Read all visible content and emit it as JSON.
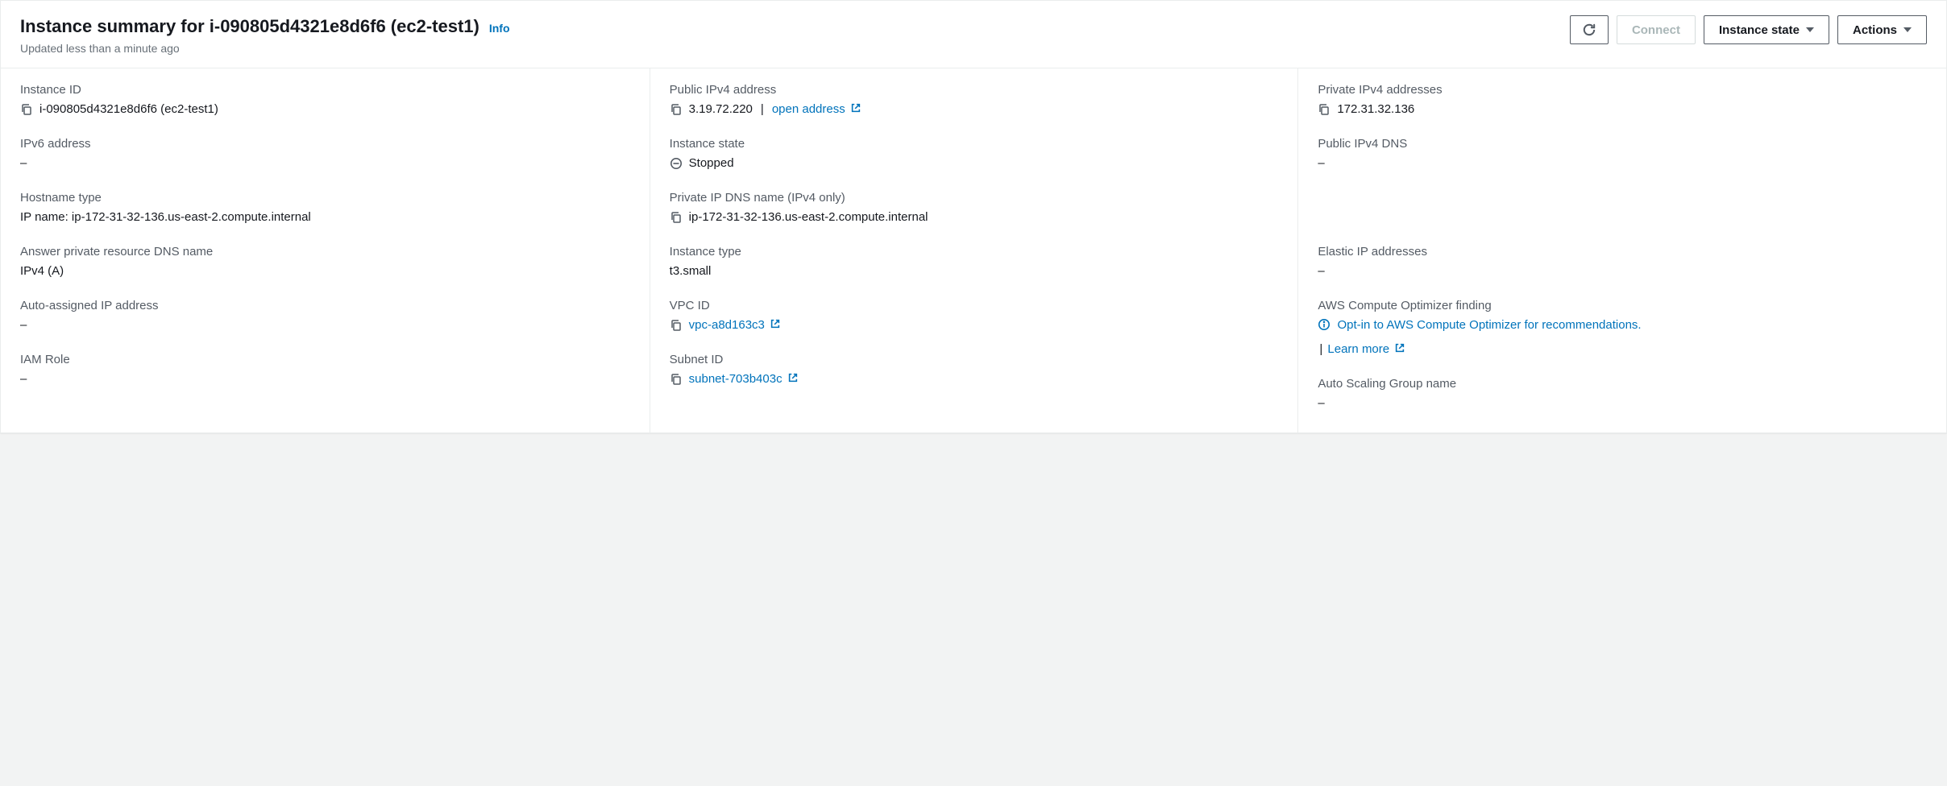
{
  "header": {
    "title_prefix": "Instance summary for ",
    "instance_id": "i-090805d4321e8d6f6",
    "instance_name": "ec2-test1",
    "info_label": "Info",
    "subtitle": "Updated less than a minute ago",
    "buttons": {
      "connect": "Connect",
      "instance_state": "Instance state",
      "actions": "Actions"
    }
  },
  "fields": {
    "instance_id": {
      "label": "Instance ID",
      "value": "i-090805d4321e8d6f6 (ec2-test1)"
    },
    "ipv6": {
      "label": "IPv6 address",
      "value": "–"
    },
    "hostname_type": {
      "label": "Hostname type",
      "value": "IP name: ip-172-31-32-136.us-east-2.compute.internal"
    },
    "answer_dns": {
      "label": "Answer private resource DNS name",
      "value": "IPv4 (A)"
    },
    "auto_ip": {
      "label": "Auto-assigned IP address",
      "value": "–"
    },
    "iam_role": {
      "label": "IAM Role",
      "value": "–"
    },
    "public_ipv4": {
      "label": "Public IPv4 address",
      "value": "3.19.72.220",
      "open": "open address"
    },
    "instance_state": {
      "label": "Instance state",
      "value": "Stopped"
    },
    "private_dns": {
      "label": "Private IP DNS name (IPv4 only)",
      "value": "ip-172-31-32-136.us-east-2.compute.internal"
    },
    "instance_type": {
      "label": "Instance type",
      "value": "t3.small"
    },
    "vpc_id": {
      "label": "VPC ID",
      "value": "vpc-a8d163c3"
    },
    "subnet_id": {
      "label": "Subnet ID",
      "value": "subnet-703b403c"
    },
    "private_ipv4": {
      "label": "Private IPv4 addresses",
      "value": "172.31.32.136"
    },
    "public_dns": {
      "label": "Public IPv4 DNS",
      "value": "–"
    },
    "elastic_ip": {
      "label": "Elastic IP addresses",
      "value": "–"
    },
    "optimizer": {
      "label": "AWS Compute Optimizer finding",
      "optin": "Opt-in to AWS Compute Optimizer for recommendations.",
      "learn": "Learn more"
    },
    "asg": {
      "label": "Auto Scaling Group name",
      "value": "–"
    }
  }
}
